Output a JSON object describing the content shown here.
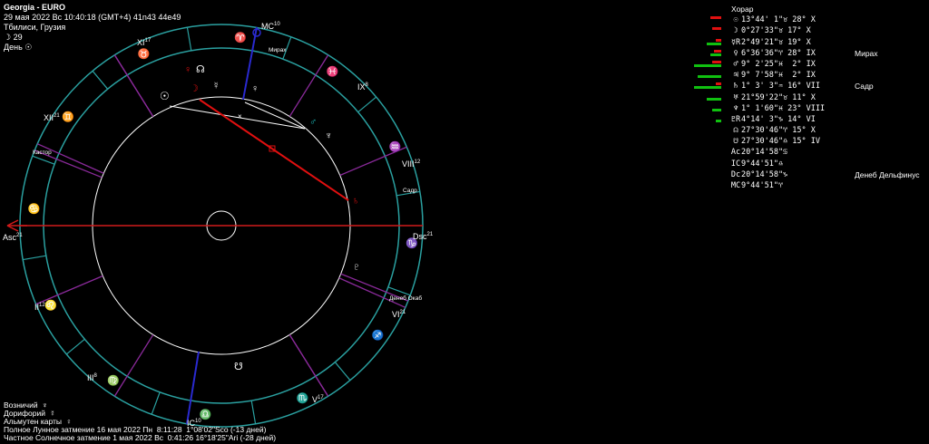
{
  "header": {
    "title": "Georgia - EURO",
    "datetime": "29 мая 2022  Вс  10:40:18 (GMT+4) 41n43  44e49",
    "place": "Тбилиси, Грузия",
    "moon_day": "☽  29",
    "day_night": "День ☉"
  },
  "chart_labels": {
    "houses": [
      {
        "name": "XI",
        "sup": "17"
      },
      {
        "name": "MC",
        "sup": "10"
      },
      {
        "name": "IX",
        "sup": "8"
      },
      {
        "name": "VIII",
        "sup": "12"
      },
      {
        "name": "Dsc",
        "sup": "21"
      },
      {
        "name": "VI",
        "sup": "21"
      },
      {
        "name": "V",
        "sup": "17"
      },
      {
        "name": "IC",
        "sup": "10"
      },
      {
        "name": "III",
        "sup": "8"
      },
      {
        "name": "II",
        "sup": "12"
      },
      {
        "name": "Asc",
        "sup": "21"
      },
      {
        "name": "XII",
        "sup": "21"
      }
    ],
    "stars": [
      "Мирах",
      "Садр",
      "Денеб Окаб",
      "Кастор"
    ]
  },
  "table": {
    "header": "Хорар",
    "rows": [
      {
        "dig": "",
        "sym": "☉",
        "pos": "13°44' 1\"♉ 28°",
        "house": "X",
        "star": "",
        "red": 12,
        "green": 0
      },
      {
        "dig": "",
        "sym": "☽",
        "pos": "0°27'33\"♉ 17°",
        "house": "X",
        "star": "",
        "red": 10,
        "green": 0
      },
      {
        "dig": "",
        "sym": "☿R",
        "pos": "2°49'21\"♉ 19°",
        "house": "X",
        "star": "",
        "red": 6,
        "green": 16
      },
      {
        "dig": "",
        "sym": "♀",
        "pos": "6°36'36\"♈ 28°",
        "house": "IX",
        "star": "Мирах",
        "red": 8,
        "green": 12
      },
      {
        "dig": "",
        "sym": "♂",
        "pos": "9° 2'25\"♓  2°",
        "house": "IX",
        "star": "",
        "red": 10,
        "green": 30
      },
      {
        "dig": "",
        "sym": "♃",
        "pos": "9° 7'58\"♓  2°",
        "house": "IX",
        "star": "",
        "red": 0,
        "green": 26
      },
      {
        "dig": "",
        "sym": "♄",
        "pos": "1° 3' 3\"♒ 16°",
        "house": "VII",
        "star": "Садр",
        "red": 6,
        "green": 30
      },
      {
        "dig": "",
        "sym": "♅",
        "pos": "21°59'22\"♉ 11°",
        "house": "X",
        "star": "",
        "red": 0,
        "green": 16
      },
      {
        "dig": "",
        "sym": "♆",
        "pos": "1° 1'60\"♓ 23°",
        "house": "VIII",
        "star": "",
        "red": 0,
        "green": 10
      },
      {
        "dig": "",
        "sym": "♇R",
        "pos": "4°14' 3\"♑ 14°",
        "house": "VI",
        "star": "",
        "red": 0,
        "green": 6
      },
      {
        "dig": "",
        "sym": "☊",
        "pos": "27°30'46\"♈ 15°",
        "house": "X",
        "star": "",
        "red": 0,
        "green": 0
      },
      {
        "dig": "",
        "sym": "☋",
        "pos": "27°30'46\"♎ 15°",
        "house": "IV",
        "star": "",
        "red": 0,
        "green": 0
      },
      {
        "dig": "",
        "sym": "Ac",
        "pos": "20°14'58\"♋",
        "house": "",
        "star": "",
        "red": 0,
        "green": 0
      },
      {
        "dig": "",
        "sym": "IC",
        "pos": "9°44'51\"♎",
        "house": "",
        "star": "",
        "red": 0,
        "green": 0
      },
      {
        "dig": "",
        "sym": "Dc",
        "pos": "20°14'58\"♑",
        "house": "",
        "star": "Денеб Дельфинус",
        "red": 0,
        "green": 0
      },
      {
        "dig": "",
        "sym": "MC",
        "pos": "9°44'51\"♈",
        "house": "",
        "star": "",
        "red": 0,
        "green": 0
      }
    ]
  },
  "footer": {
    "voznichiy": "Возничий  ♆",
    "doriforiy": "Дорифорий  ☿",
    "almuten": "Альмутен карты  ♀",
    "lunar": "Полное Лунное затмение 16 мая 2022 Пн  8:11:28  1°08'02\"Sco (-13 дней)",
    "solar": "Частное Солнечное затмение 1 мая 2022 Вс  0:41:26 16°18'25\"Ari (-28 дней)"
  },
  "colors": {
    "ring": "#2aa0a0",
    "sign": "#1cc0c0",
    "house": "#8a2a9a",
    "axis": "#d01a1a",
    "mc": "#2a2ad0",
    "aspect_red": "#e01010",
    "aspect_white": "#ffffff"
  }
}
